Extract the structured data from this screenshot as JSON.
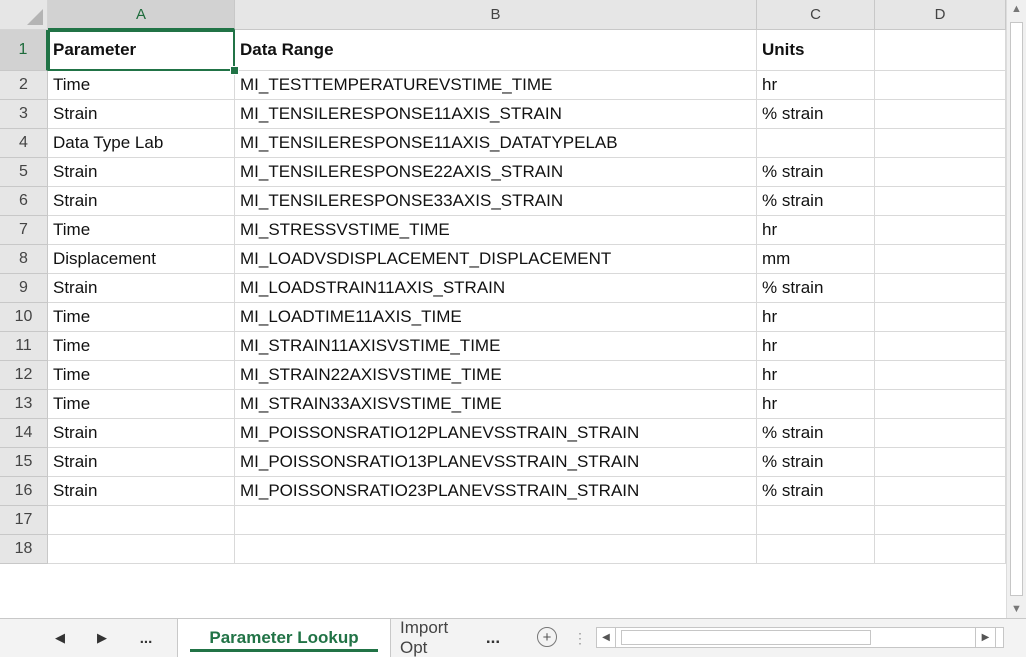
{
  "columns": [
    "A",
    "B",
    "C",
    "D"
  ],
  "rows": [
    {
      "num": "1",
      "a": "Parameter",
      "b": "Data Range",
      "c": "Units"
    },
    {
      "num": "2",
      "a": "Time",
      "b": "MI_TESTTEMPERATUREVSTIME_TIME",
      "c": "hr"
    },
    {
      "num": "3",
      "a": "Strain",
      "b": "MI_TENSILERESPONSE11AXIS_STRAIN",
      "c": "% strain"
    },
    {
      "num": "4",
      "a": "Data Type Lab",
      "b": "MI_TENSILERESPONSE11AXIS_DATATYPELAB",
      "c": ""
    },
    {
      "num": "5",
      "a": "Strain",
      "b": "MI_TENSILERESPONSE22AXIS_STRAIN",
      "c": "% strain"
    },
    {
      "num": "6",
      "a": "Strain",
      "b": "MI_TENSILERESPONSE33AXIS_STRAIN",
      "c": "% strain"
    },
    {
      "num": "7",
      "a": "Time",
      "b": "MI_STRESSVSTIME_TIME",
      "c": "hr"
    },
    {
      "num": "8",
      "a": "Displacement",
      "b": "MI_LOADVSDISPLACEMENT_DISPLACEMENT",
      "c": "mm"
    },
    {
      "num": "9",
      "a": "Strain",
      "b": "MI_LOADSTRAIN11AXIS_STRAIN",
      "c": "% strain"
    },
    {
      "num": "10",
      "a": "Time",
      "b": "MI_LOADTIME11AXIS_TIME",
      "c": "hr"
    },
    {
      "num": "11",
      "a": "Time",
      "b": "MI_STRAIN11AXISVSTIME_TIME",
      "c": "hr"
    },
    {
      "num": "12",
      "a": "Time",
      "b": "MI_STRAIN22AXISVSTIME_TIME",
      "c": "hr"
    },
    {
      "num": "13",
      "a": "Time",
      "b": "MI_STRAIN33AXISVSTIME_TIME",
      "c": "hr"
    },
    {
      "num": "14",
      "a": "Strain",
      "b": "MI_POISSONSRATIO12PLANEVSSTRAIN_STRAIN",
      "c": "% strain"
    },
    {
      "num": "15",
      "a": "Strain",
      "b": "MI_POISSONSRATIO13PLANEVSSTRAIN_STRAIN",
      "c": "% strain"
    },
    {
      "num": "16",
      "a": "Strain",
      "b": "MI_POISSONSRATIO23PLANEVSSTRAIN_STRAIN",
      "c": "% strain"
    },
    {
      "num": "17",
      "a": "",
      "b": "",
      "c": ""
    },
    {
      "num": "18",
      "a": "",
      "b": "",
      "c": ""
    }
  ],
  "tabs": {
    "prev_icon": "triangle-left-icon",
    "next_icon": "triangle-right-icon",
    "more_left": "...",
    "active": "Parameter Lookup",
    "other": "Import Opt",
    "more_right": "...",
    "add_icon": "plus-circle-icon"
  },
  "colors": {
    "accent": "#217346",
    "header_bg": "#e6e6e6",
    "gridline": "#d9d9d9"
  }
}
